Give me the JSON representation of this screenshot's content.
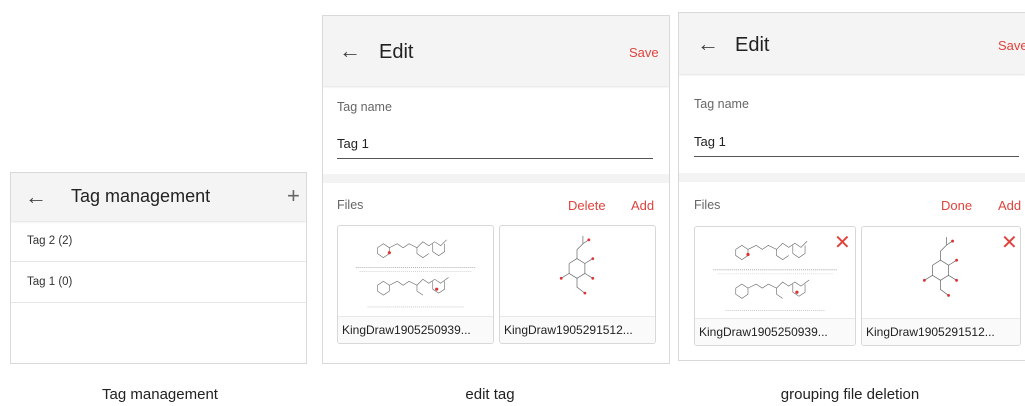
{
  "panel1": {
    "title": "Tag management",
    "back_glyph": "←",
    "add_glyph": "+",
    "tags": [
      {
        "label": "Tag 2 (2)"
      },
      {
        "label": "Tag 1 (0)"
      }
    ],
    "caption": "Tag management"
  },
  "panel2": {
    "title": "Edit",
    "back_glyph": "←",
    "save_label": "Save",
    "tag_name_label": "Tag name",
    "tag_name_value": "Tag 1",
    "files_label": "Files",
    "delete_label": "Delete",
    "add_label": "Add",
    "files": [
      {
        "name": "KingDraw1905250939..."
      },
      {
        "name": "KingDraw1905291512..."
      }
    ],
    "caption": "edit tag"
  },
  "panel3": {
    "title": "Edit",
    "back_glyph": "←",
    "save_label": "Save",
    "tag_name_label": "Tag name",
    "tag_name_value": "Tag 1",
    "files_label": "Files",
    "done_label": "Done",
    "add_label": "Add",
    "remove_glyph": "✕",
    "files": [
      {
        "name": "KingDraw1905250939..."
      },
      {
        "name": "KingDraw1905291512..."
      }
    ],
    "caption": "grouping file deletion"
  },
  "colors": {
    "accent": "#e0433c",
    "header_bg": "#f4f4f4"
  }
}
